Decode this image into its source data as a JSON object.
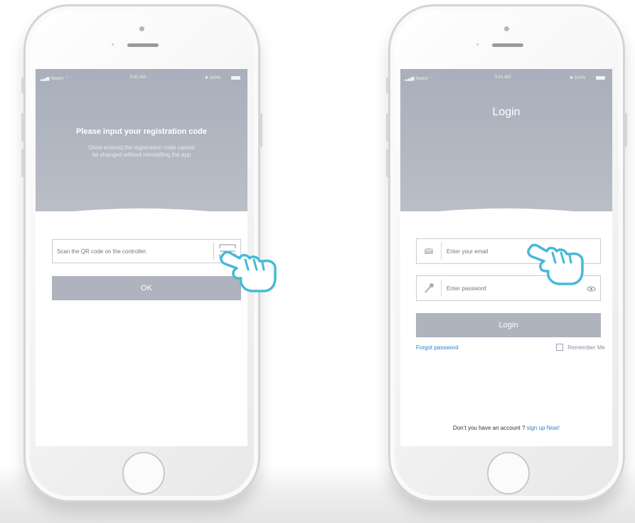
{
  "left_phone": {
    "status_bar": {
      "carrier": "Sketch",
      "time": "9:41 AM",
      "battery": "100%"
    },
    "title": "Please input your registration code",
    "subtitle": "Once entered,the registration code cannot be changed without reinstalling the app",
    "qr_input_placeholder": "Scan the QR code on the controller.",
    "ok_label": "OK"
  },
  "right_phone": {
    "status_bar": {
      "carrier": "Sketch",
      "time": "9:41 AM",
      "battery": "100%"
    },
    "title": "Login",
    "email_placeholder": "Enter your email",
    "password_placeholder": "Enter password",
    "login_label": "Login",
    "forgot_label": "Forgot password",
    "remember_label": "Remember Me",
    "signup_prompt": "Don’t you have an account ?",
    "signup_link": "sign up Now!"
  },
  "colors": {
    "header_gray": "#b0b5bf",
    "button_gray": "#aeb3bd",
    "link_blue": "#2d82c9",
    "hand_outline": "#46b9d6"
  },
  "icons": [
    "scan-icon",
    "email-icon",
    "key-icon",
    "eye-icon",
    "pointer-hand-icon"
  ]
}
